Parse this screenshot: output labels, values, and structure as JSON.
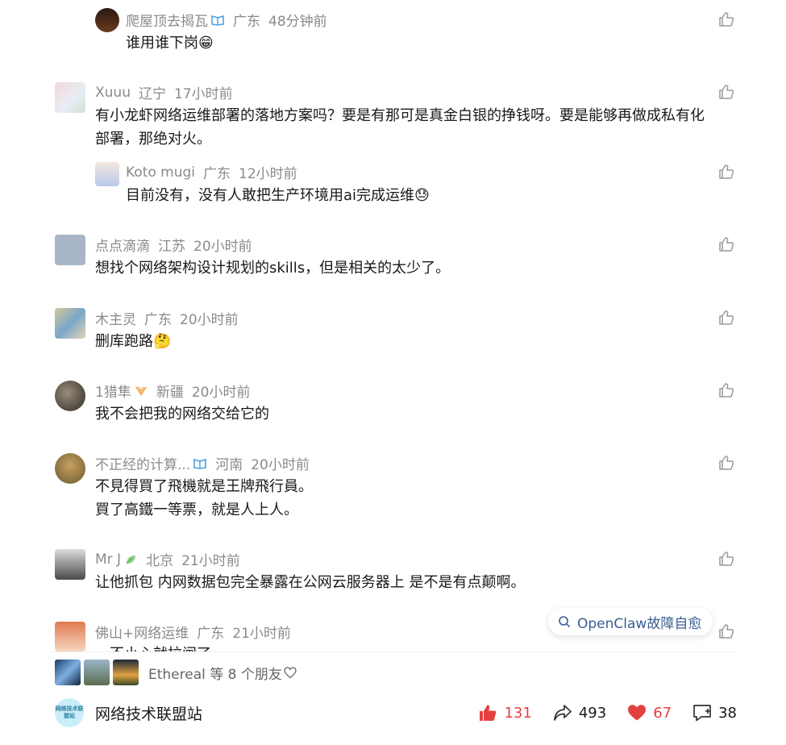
{
  "comments": [
    {
      "user": "爬屋顶去揭瓦",
      "location": "广东",
      "time": "48分钟前",
      "text": "谁用谁下岗😁",
      "badge": "verified-book-icon"
    },
    {
      "user": "Xuuu",
      "location": "辽宁",
      "time": "17小时前",
      "text_line1": "有小龙虾网络运维部署的落地方案吗？要是有那可是真金白银的挣钱呀。要是能够再做成私有化",
      "text_line2": "部署，那绝对火。"
    },
    {
      "user": "Koto mugi",
      "location": "广东",
      "time": "12小时前",
      "text": "目前没有，没有人敢把生产环境用ai完成运维😓"
    },
    {
      "user": "点点滴滴",
      "location": "江苏",
      "time": "20小时前",
      "text": "想找个网络架构设计规划的skills，但是相关的太少了。"
    },
    {
      "user": "木主灵",
      "location": "广东",
      "time": "20小时前",
      "text": "删库跑路🤔"
    },
    {
      "user": "1猎隼",
      "location": "新疆",
      "time": "20小时前",
      "text": "我不会把我的网络交给它的",
      "badge": "orange-badge-icon"
    },
    {
      "user": "不正经的计算...",
      "location": "河南",
      "time": "20小时前",
      "text_line1": "不見得買了飛機就是王牌飛行員。",
      "text_line2": "買了高鐵一等票，就是人上人。",
      "badge": "verified-book-icon"
    },
    {
      "user": "Mr J",
      "location": "北京",
      "time": "21小时前",
      "text": "让他抓包 内网数据包完全暴露在公网云服务器上 是不是有点颠啊。",
      "badge": "green-leaf-icon"
    },
    {
      "user": "佛山+网络运维",
      "location": "广东",
      "time": "21小时前",
      "text": "一不小心就拉闸了"
    }
  ],
  "floating_search": {
    "label": "OpenClaw故障自愈",
    "icon": "search-icon"
  },
  "friends": {
    "text": "Ethereal 等 8 个朋友",
    "icon": "heart-outline-icon"
  },
  "footer": {
    "site_name": "网络技术联盟站",
    "logo_text": "网络技术联盟站",
    "likes": "131",
    "shares": "493",
    "favorites": "67",
    "comments": "38"
  },
  "colors": {
    "accent_red": "#e54040",
    "meta_gray": "#8a8a8a",
    "link_blue": "#3a5d93"
  }
}
